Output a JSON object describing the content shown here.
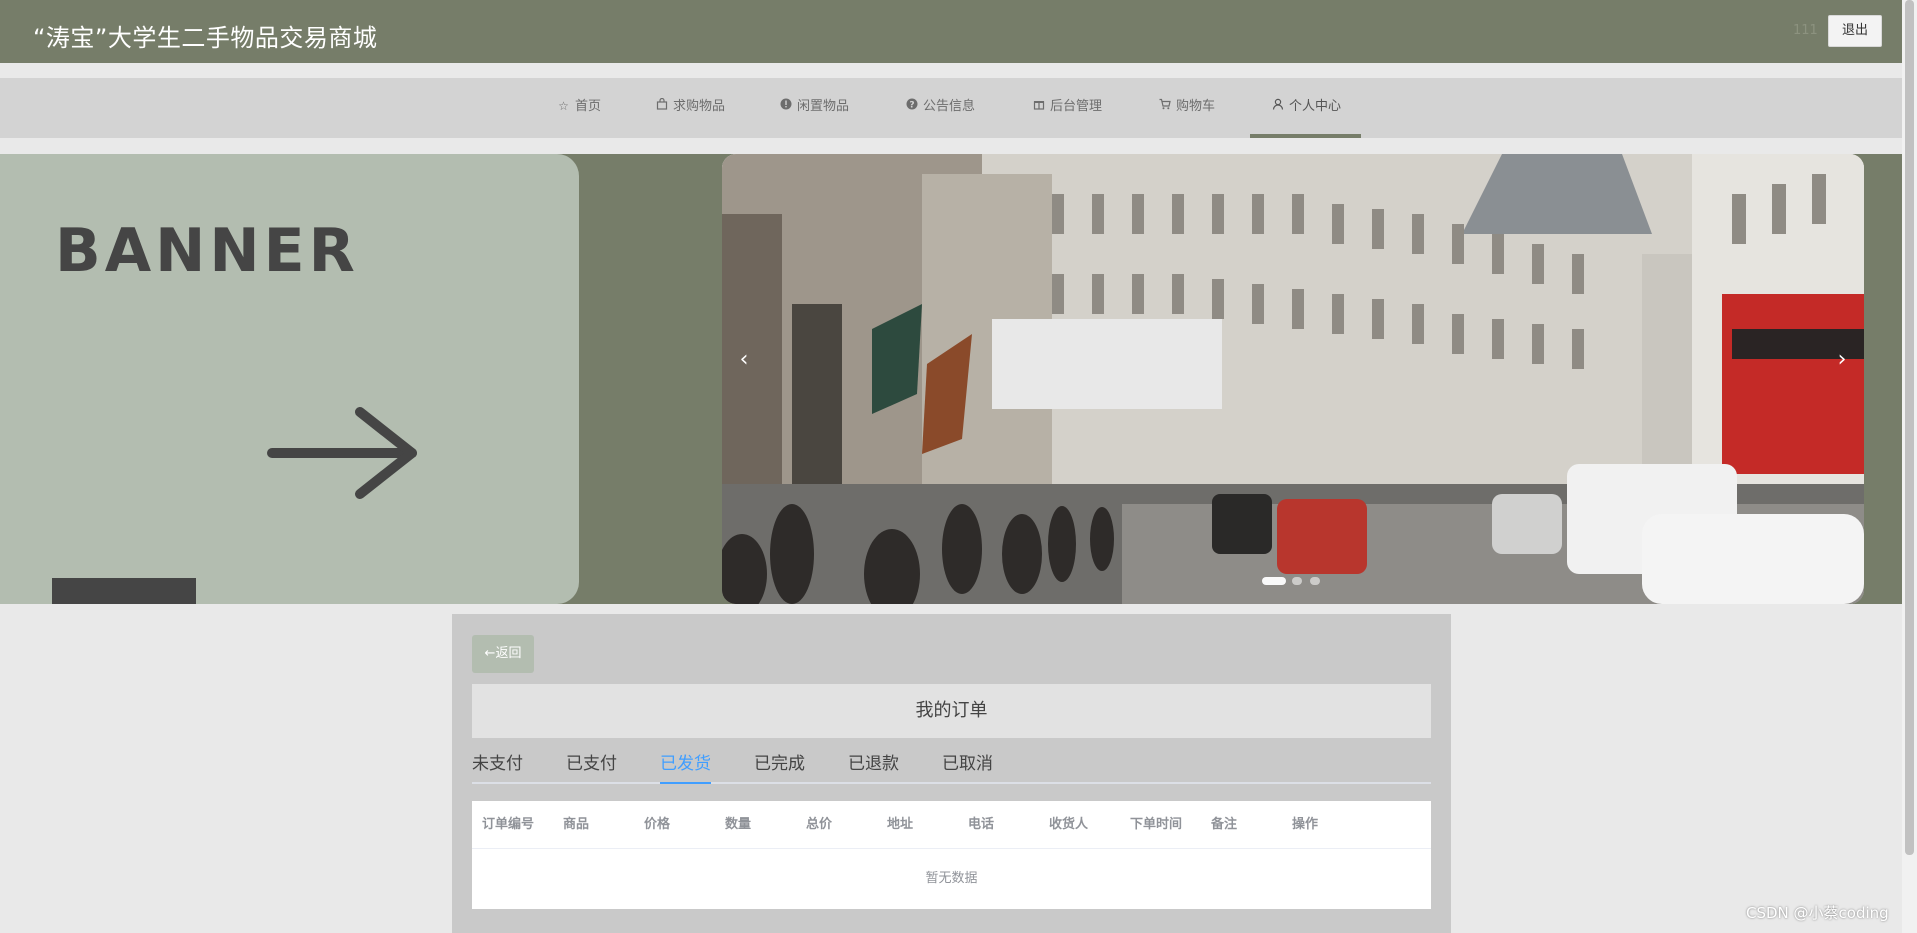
{
  "header": {
    "site_title": "“涛宝”大学生二手物品交易商城",
    "user_name": "111",
    "logout_label": "退出"
  },
  "nav": {
    "items": [
      {
        "label": "首页",
        "icon": "star-icon"
      },
      {
        "label": "求购物品",
        "icon": "bag-icon"
      },
      {
        "label": "闲置物品",
        "icon": "info-icon"
      },
      {
        "label": "公告信息",
        "icon": "question-icon"
      },
      {
        "label": "后台管理",
        "icon": "gift-icon"
      },
      {
        "label": "购物车",
        "icon": "cart-icon"
      },
      {
        "label": "个人中心",
        "icon": "user-icon"
      }
    ],
    "active_index": 6
  },
  "banner": {
    "word": "BANNER",
    "prev_symbol": "‹",
    "next_symbol": "›",
    "slide_count": 3,
    "active_slide": 0
  },
  "orders": {
    "back_label": "←返回",
    "title": "我的订单",
    "tabs": [
      "未支付",
      "已支付",
      "已发货",
      "已完成",
      "已退款",
      "已取消"
    ],
    "active_tab": 2,
    "columns": [
      "订单编号",
      "商品",
      "价格",
      "数量",
      "总价",
      "地址",
      "电话",
      "收货人",
      "下单时间",
      "备注",
      "操作"
    ],
    "empty_text": "暂无数据"
  },
  "watermark": "CSDN @小蔡coding",
  "colors": {
    "header_bg": "#767d69",
    "nav_bg": "#d3d3d3",
    "banner_card": "#b3bdb0",
    "active_tab": "#409eff"
  }
}
